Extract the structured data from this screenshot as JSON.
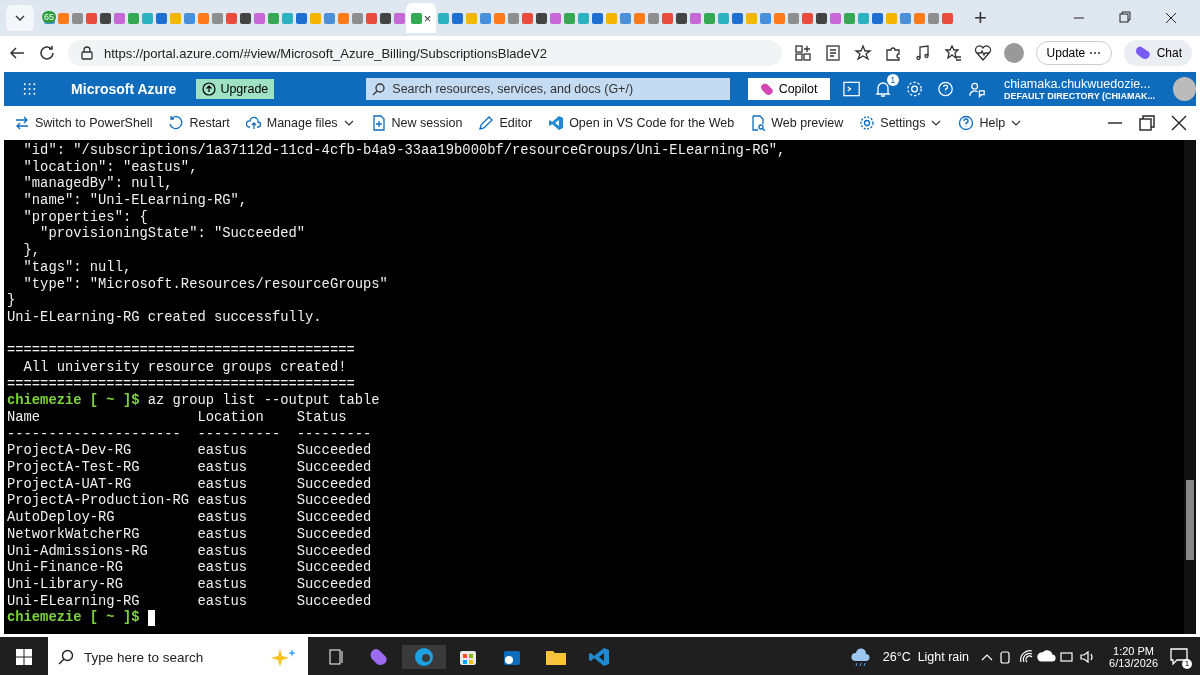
{
  "browser": {
    "tabs": [
      {
        "selected": false,
        "badge": "65"
      },
      {
        "selected": false
      },
      {
        "selected": false
      },
      {
        "selected": false
      },
      {
        "selected": false
      },
      {
        "selected": false
      },
      {
        "selected": false
      },
      {
        "selected": false
      },
      {
        "selected": false
      },
      {
        "selected": false
      },
      {
        "selected": false
      },
      {
        "selected": false
      },
      {
        "selected": false
      },
      {
        "selected": false
      },
      {
        "selected": false
      },
      {
        "selected": false
      },
      {
        "selected": false
      },
      {
        "selected": false
      },
      {
        "selected": false
      },
      {
        "selected": false
      },
      {
        "selected": false
      },
      {
        "selected": false
      },
      {
        "selected": false
      },
      {
        "selected": false
      },
      {
        "selected": false
      },
      {
        "selected": false
      },
      {
        "selected": true
      },
      {
        "selected": false
      },
      {
        "selected": false
      },
      {
        "selected": false
      },
      {
        "selected": false
      },
      {
        "selected": false
      },
      {
        "selected": false
      },
      {
        "selected": false
      },
      {
        "selected": false
      },
      {
        "selected": false
      },
      {
        "selected": false
      },
      {
        "selected": false
      },
      {
        "selected": false
      },
      {
        "selected": false
      },
      {
        "selected": false
      },
      {
        "selected": false
      },
      {
        "selected": false
      },
      {
        "selected": false
      },
      {
        "selected": false
      },
      {
        "selected": false
      },
      {
        "selected": false
      },
      {
        "selected": false
      },
      {
        "selected": false
      },
      {
        "selected": false
      },
      {
        "selected": false
      },
      {
        "selected": false
      },
      {
        "selected": false
      },
      {
        "selected": false
      },
      {
        "selected": false
      },
      {
        "selected": false
      },
      {
        "selected": false
      },
      {
        "selected": false
      },
      {
        "selected": false
      },
      {
        "selected": false
      },
      {
        "selected": false
      },
      {
        "selected": false
      },
      {
        "selected": false
      },
      {
        "selected": false
      }
    ],
    "close_tab": "×",
    "new_tab": "+",
    "url": "https://portal.azure.com/#view/Microsoft_Azure_Billing/SubscriptionsBladeV2",
    "update_button": "Update",
    "update_more": "⋯",
    "chat_button": "Chat"
  },
  "azure": {
    "brand": "Microsoft Azure",
    "upgrade": "Upgrade",
    "search": {
      "placeholder": "Search resources, services, and docs (G+/)"
    },
    "copilot": "Copilot",
    "notification_count": "1",
    "user_name": "chiamaka.chukwuedozie...",
    "directory": "DEFAULT DIRECTORY (CHIAMAK..."
  },
  "toolbar": [
    {
      "label": "Switch to PowerShell",
      "kind": "switch",
      "dropdown": false
    },
    {
      "label": "Restart",
      "kind": "restart",
      "dropdown": false
    },
    {
      "label": "Manage files",
      "kind": "cloud",
      "dropdown": true
    },
    {
      "label": "New session",
      "kind": "new",
      "dropdown": false
    },
    {
      "label": "Editor",
      "kind": "pencil",
      "dropdown": false
    },
    {
      "label": "Open in VS Code for the Web",
      "kind": "vscode",
      "dropdown": false
    },
    {
      "label": "Web preview",
      "kind": "preview",
      "dropdown": false
    },
    {
      "label": "Settings",
      "kind": "gear",
      "dropdown": true
    },
    {
      "label": "Help",
      "kind": "help",
      "dropdown": true
    }
  ],
  "terminal": {
    "lines": [
      {
        "kind": "text",
        "text": "  \"id\": \"/subscriptions/1a37112d-11cd-4cfb-b4a9-33aa19b000bf/resourceGroups/Uni-ELearning-RG\","
      },
      {
        "kind": "text",
        "text": "  \"location\": \"eastus\","
      },
      {
        "kind": "text",
        "text": "  \"managedBy\": null,"
      },
      {
        "kind": "text",
        "text": "  \"name\": \"Uni-ELearning-RG\","
      },
      {
        "kind": "text",
        "text": "  \"properties\": {"
      },
      {
        "kind": "text",
        "text": "    \"provisioningState\": \"Succeeded\""
      },
      {
        "kind": "text",
        "text": "  },"
      },
      {
        "kind": "text",
        "text": "  \"tags\": null,"
      },
      {
        "kind": "text",
        "text": "  \"type\": \"Microsoft.Resources/resourceGroups\""
      },
      {
        "kind": "text",
        "text": "}"
      },
      {
        "kind": "text",
        "text": "Uni-ELearning-RG created successfully."
      },
      {
        "kind": "blank"
      },
      {
        "kind": "text",
        "text": "=========================================="
      },
      {
        "kind": "text",
        "text": "  All university resource groups created!"
      },
      {
        "kind": "text",
        "text": "=========================================="
      },
      {
        "kind": "prompt",
        "prompt": "chiemezie [ ~ ]$",
        "text": "az group list --output table"
      },
      {
        "kind": "text",
        "text": "Name                   Location    Status"
      },
      {
        "kind": "text",
        "text": "---------------------  ----------  ---------"
      },
      {
        "kind": "text",
        "text": "ProjectA-Dev-RG        eastus      Succeeded"
      },
      {
        "kind": "text",
        "text": "ProjectA-Test-RG       eastus      Succeeded"
      },
      {
        "kind": "text",
        "text": "ProjectA-UAT-RG        eastus      Succeeded"
      },
      {
        "kind": "text",
        "text": "ProjectA-Production-RG eastus      Succeeded"
      },
      {
        "kind": "text",
        "text": "AutoDeploy-RG          eastus      Succeeded"
      },
      {
        "kind": "text",
        "text": "NetworkWatcherRG       eastus      Succeeded"
      },
      {
        "kind": "text",
        "text": "Uni-Admissions-RG      eastus      Succeeded"
      },
      {
        "kind": "text",
        "text": "Uni-Finance-RG         eastus      Succeeded"
      },
      {
        "kind": "text",
        "text": "Uni-Library-RG         eastus      Succeeded"
      },
      {
        "kind": "text",
        "text": "Uni-ELearning-RG       eastus      Succeeded"
      },
      {
        "kind": "prompt",
        "prompt": "chiemezie [ ~ ]$",
        "cursor": true
      }
    ]
  },
  "taskbar": {
    "search": {
      "placeholder": "Type here to search"
    },
    "weather": "26°C  Light rain",
    "time": "1:20 PM",
    "date": "6/13/2026",
    "notification_count": "1"
  }
}
